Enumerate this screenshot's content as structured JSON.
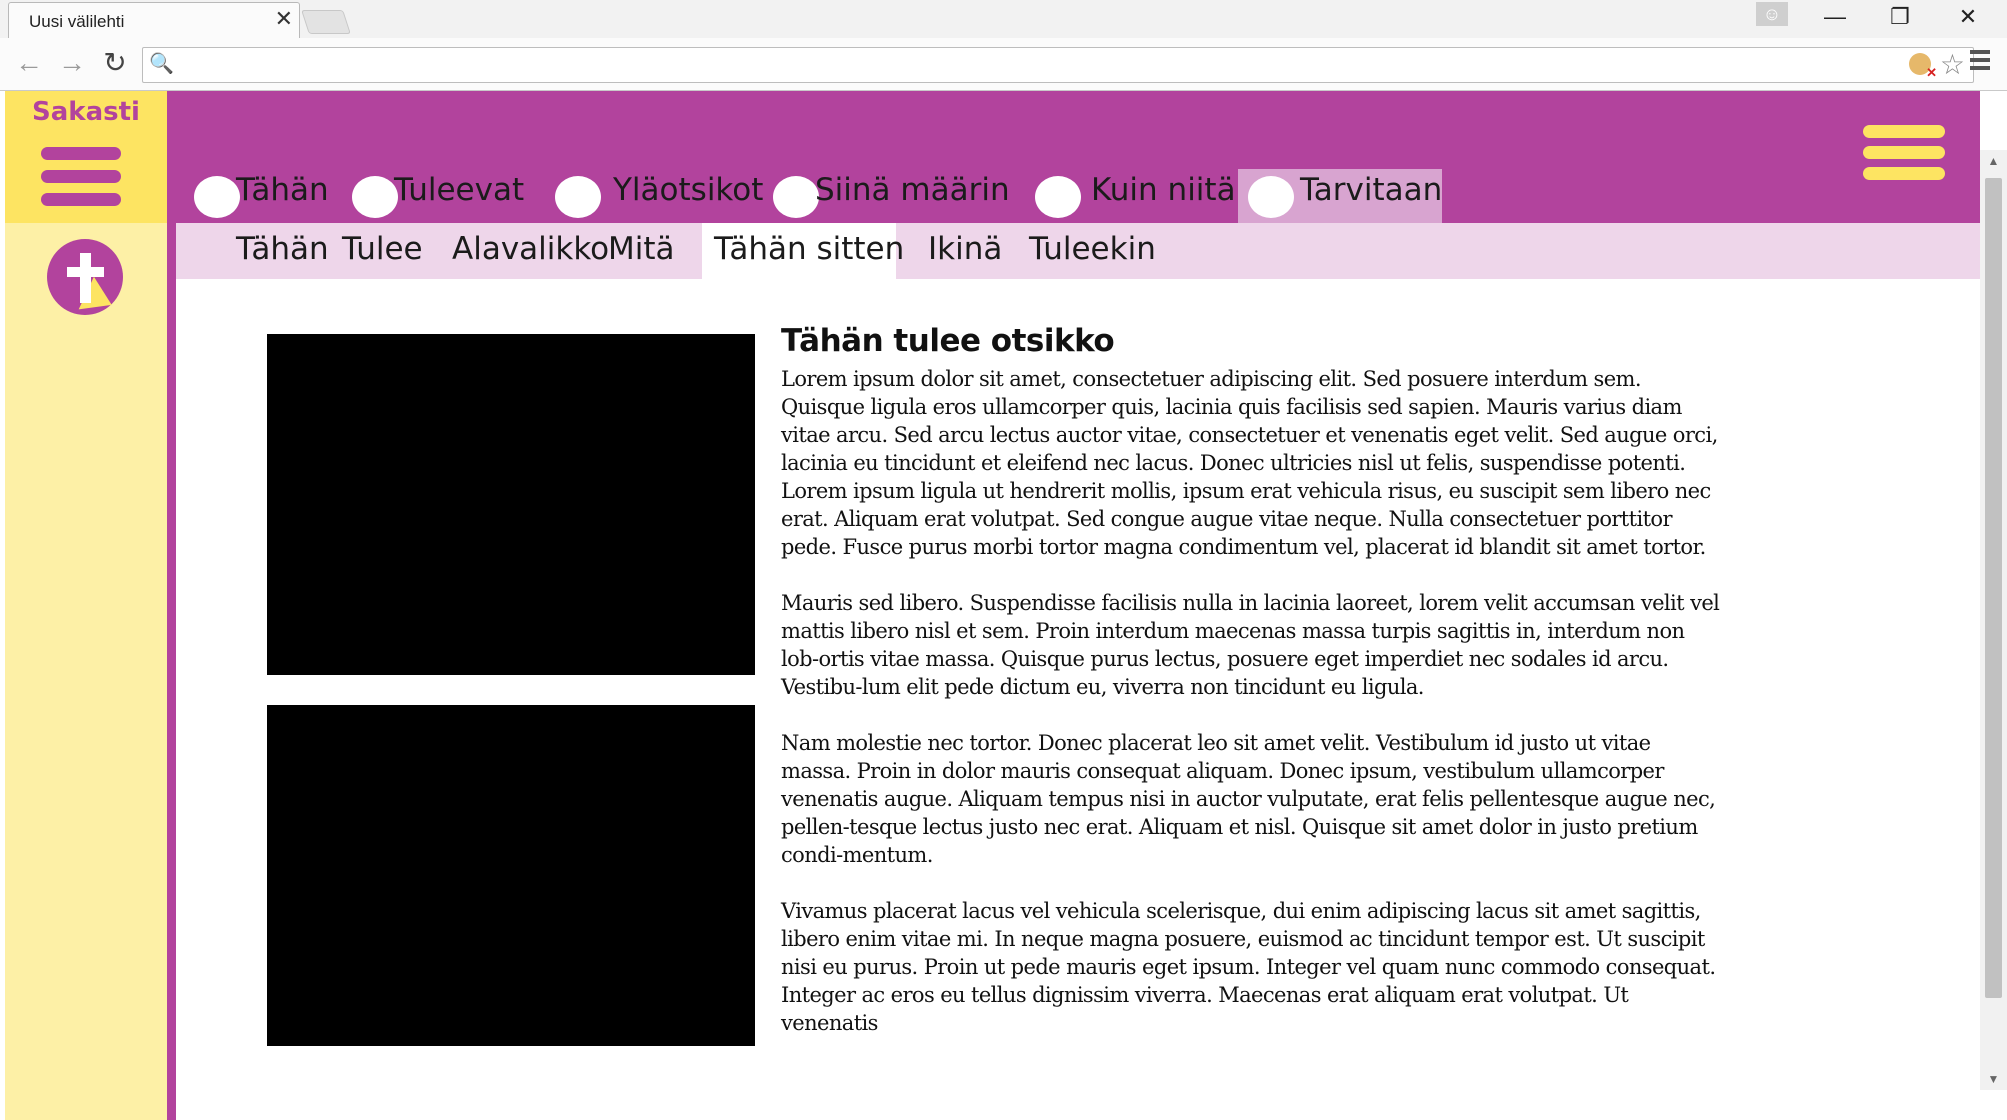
{
  "browser": {
    "tab_title": "Uusi välilehti",
    "tab_close": "✕",
    "url": "",
    "buttons": {
      "back": "←",
      "forward": "→",
      "reload": "↻",
      "minimize": "—",
      "restore": "❐",
      "close": "✕"
    },
    "icons": [
      "search-icon",
      "user-icon",
      "extension-icon",
      "star-icon",
      "menu-icon"
    ]
  },
  "site": {
    "brand": "Sakasti",
    "main_nav": [
      "Tähän",
      "Tuleevat",
      "Yläotsikot",
      "Siinä määrin",
      "Kuin niitä",
      "Tarvitaan"
    ],
    "main_nav_active": "Tarvitaan",
    "sub_nav": [
      "Tähän",
      "Tulee",
      "Alavalikko",
      "Mitä",
      "Tähän sitten",
      "Ikinä",
      "Tuleekin"
    ],
    "sub_nav_active": "Tähän sitten"
  },
  "article": {
    "title": "Tähän tulee otsikko",
    "paragraphs": [
      "Lorem ipsum dolor sit amet, consectetuer adipiscing elit. Sed posuere interdum sem. Quisque ligula eros ullamcorper quis, lacinia quis facilisis sed sapien. Mauris varius diam vitae arcu. Sed arcu lectus auctor vitae, consectetuer et venenatis eget velit. Sed augue orci, lacinia eu tincidunt et eleifend nec lacus. Donec ultricies nisl ut felis, suspendisse potenti. Lorem ipsum ligula ut hendrerit mollis, ipsum erat vehicula risus, eu suscipit sem libero nec erat. Aliquam erat volutpat. Sed congue augue vitae neque. Nulla consectetuer porttitor pede. Fusce purus morbi tortor magna condimentum vel, placerat id blandit sit amet tortor.",
      "Mauris sed libero. Suspendisse facilisis nulla in lacinia laoreet, lorem velit accumsan velit vel mattis libero nisl et sem. Proin interdum maecenas massa turpis sagittis in, interdum non lob-ortis vitae massa. Quisque purus lectus, posuere eget imperdiet nec sodales id arcu. Vestibu-lum elit pede dictum eu, viverra non tincidunt eu ligula.",
      "Nam molestie nec tortor. Donec placerat leo sit amet velit. Vestibulum id justo ut vitae massa. Proin in dolor mauris consequat aliquam. Donec ipsum, vestibulum ullamcorper venenatis augue. Aliquam tempus nisi in auctor vulputate, erat felis pellentesque augue nec, pellen-tesque lectus justo nec erat. Aliquam et nisl. Quisque sit amet dolor in justo pretium condi-mentum.",
      "Vivamus placerat lacus vel vehicula scelerisque, dui enim adipiscing lacus sit amet sagittis, libero enim vitae mi. In neque magna posuere, euismod ac tincidunt tempor est. Ut suscipit nisi eu purus. Proin ut pede mauris eget ipsum. Integer vel quam nunc commodo consequat. Integer ac eros eu tellus dignissim viverra. Maecenas erat aliquam erat volutpat. Ut venenatis"
    ]
  },
  "colors": {
    "primary": "#b2439d",
    "accent_yellow": "#fde462",
    "sidebar_light": "#fdf0a6",
    "subnav_bg": "#eed6ea",
    "active_tab": "#d8a4d0"
  }
}
